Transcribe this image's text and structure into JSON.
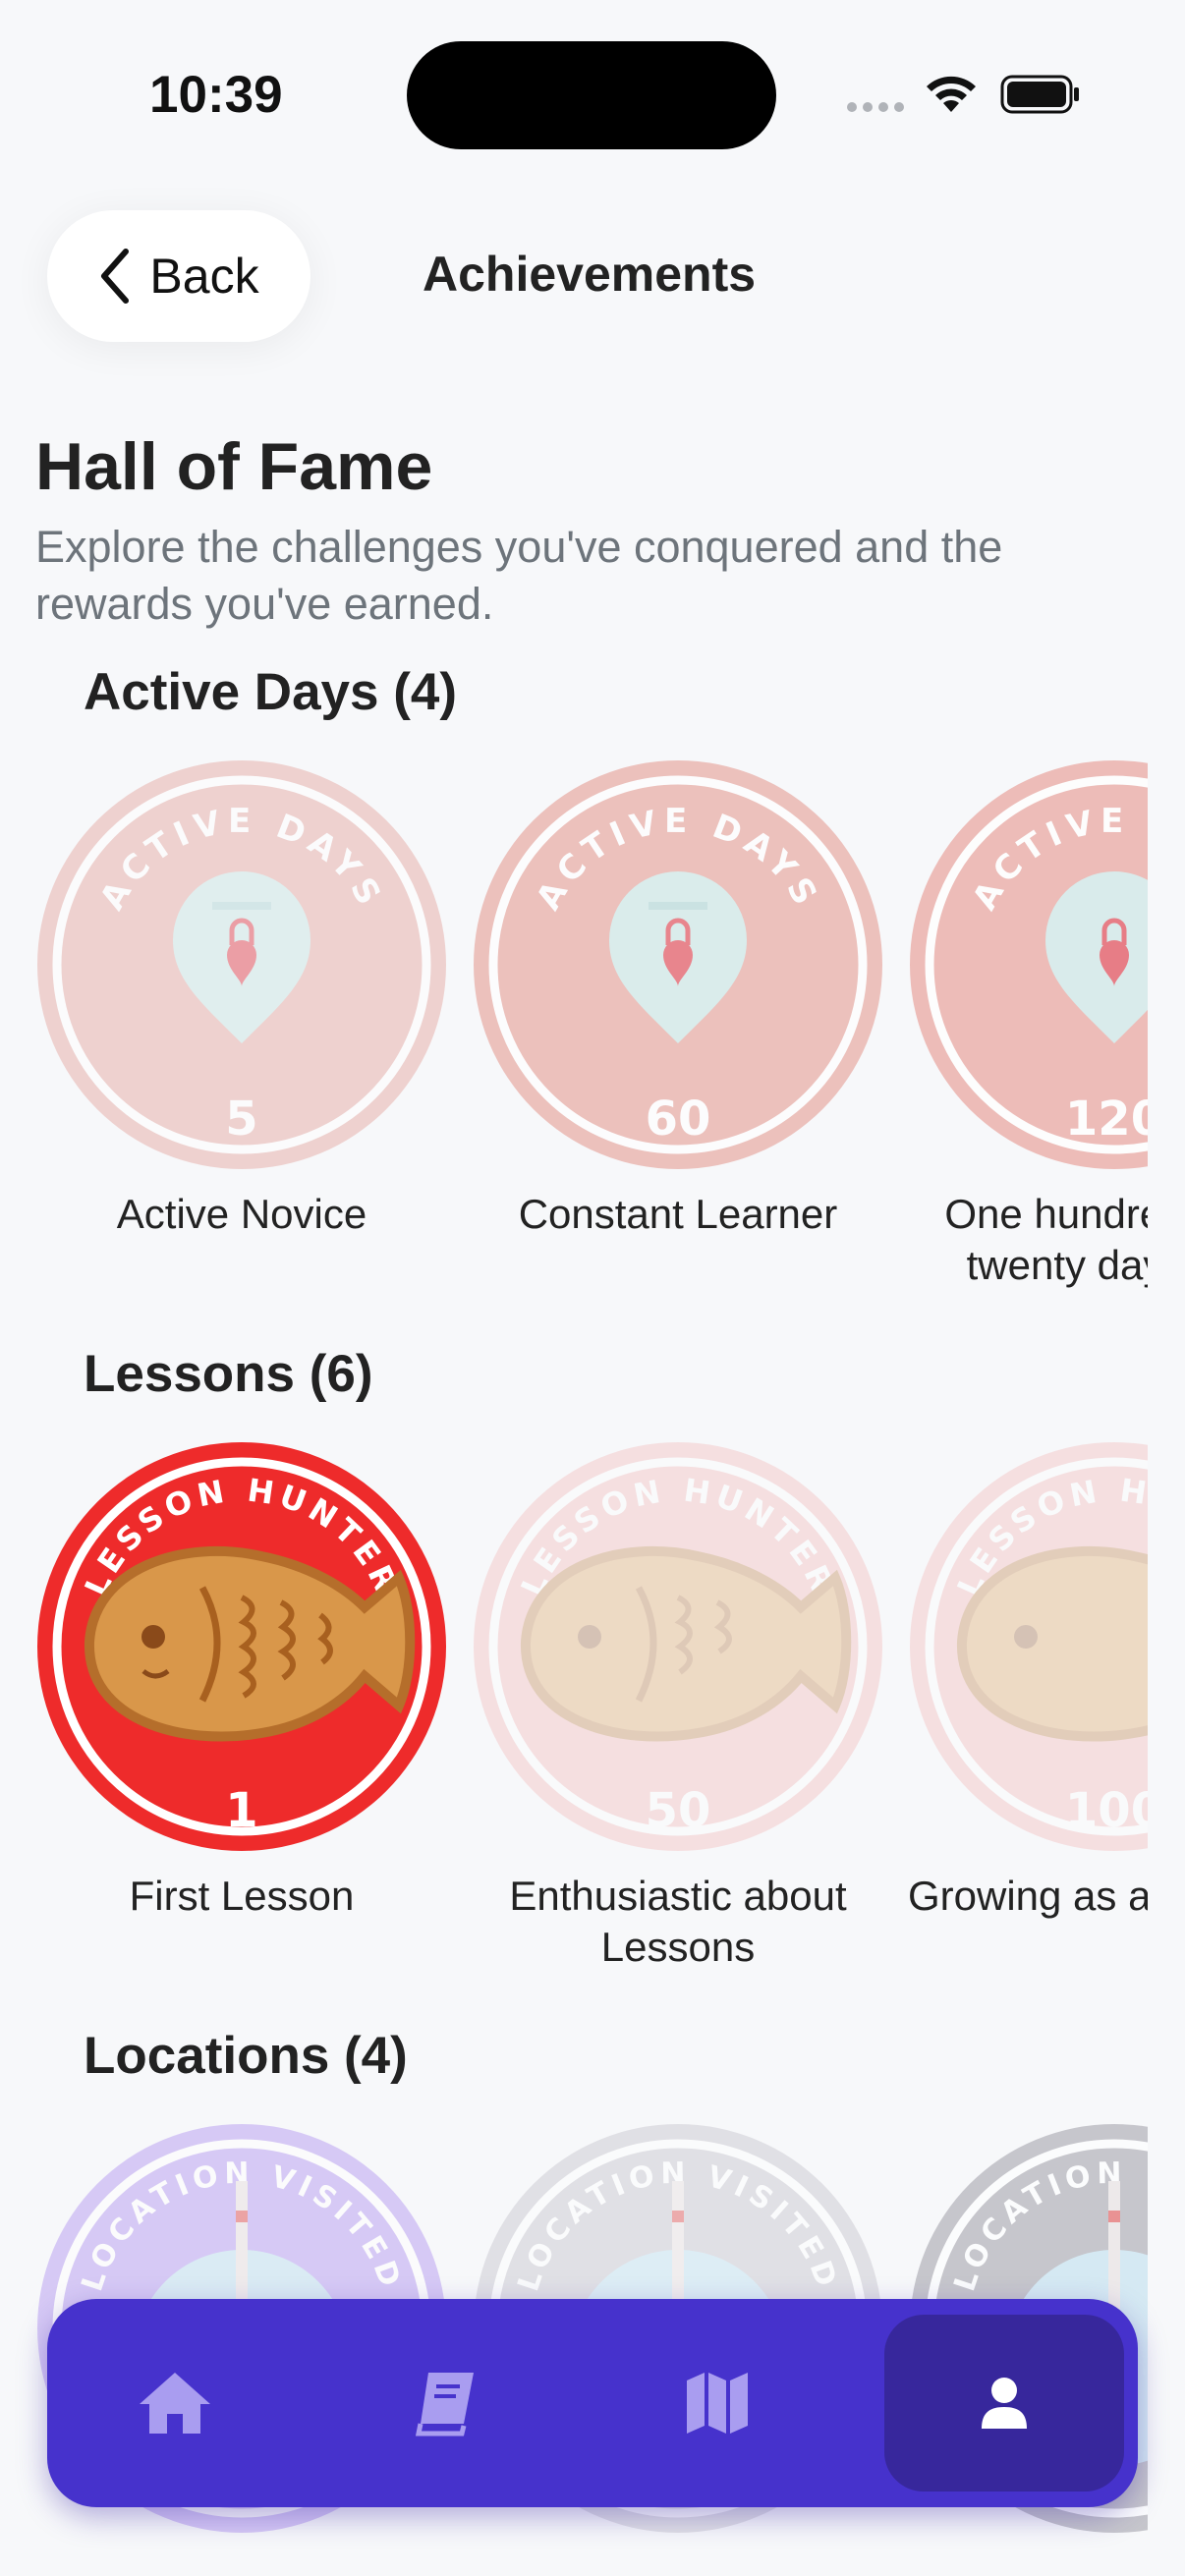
{
  "status": {
    "time": "10:39"
  },
  "nav": {
    "back_label": "Back",
    "title": "Achievements"
  },
  "header": {
    "title": "Hall of Fame",
    "subtitle": "Explore the challenges you've conquered and the rewards you've earned."
  },
  "sections": [
    {
      "title": "Active Days (4)",
      "badge_arc": "ACTIVE DAYS",
      "badges": [
        {
          "number": "5",
          "label": "Active Novice",
          "unlocked": false
        },
        {
          "number": "60",
          "label": "Constant Learner",
          "unlocked": false
        },
        {
          "number": "120",
          "label": "One hundred twenty day",
          "unlocked": false
        }
      ]
    },
    {
      "title": "Lessons (6)",
      "badge_arc": "LESSON HUNTER",
      "badges": [
        {
          "number": "1",
          "label": "First Lesson",
          "unlocked": true
        },
        {
          "number": "50",
          "label": "Enthusiastic about Lessons",
          "unlocked": false
        },
        {
          "number": "100",
          "label": "Growing as a",
          "unlocked": false
        }
      ]
    },
    {
      "title": "Locations (4)",
      "badge_arc": "LOCATION VISITED",
      "badges": []
    }
  ],
  "tabs": [
    {
      "icon": "home-icon"
    },
    {
      "icon": "book-icon"
    },
    {
      "icon": "map-icon"
    },
    {
      "icon": "profile-icon",
      "active": true
    }
  ],
  "colors": {
    "accent": "#4632cc",
    "accent_active": "#37279c",
    "badge_red": "#ee2b2b",
    "badge_pink": "#f0c9c5"
  }
}
